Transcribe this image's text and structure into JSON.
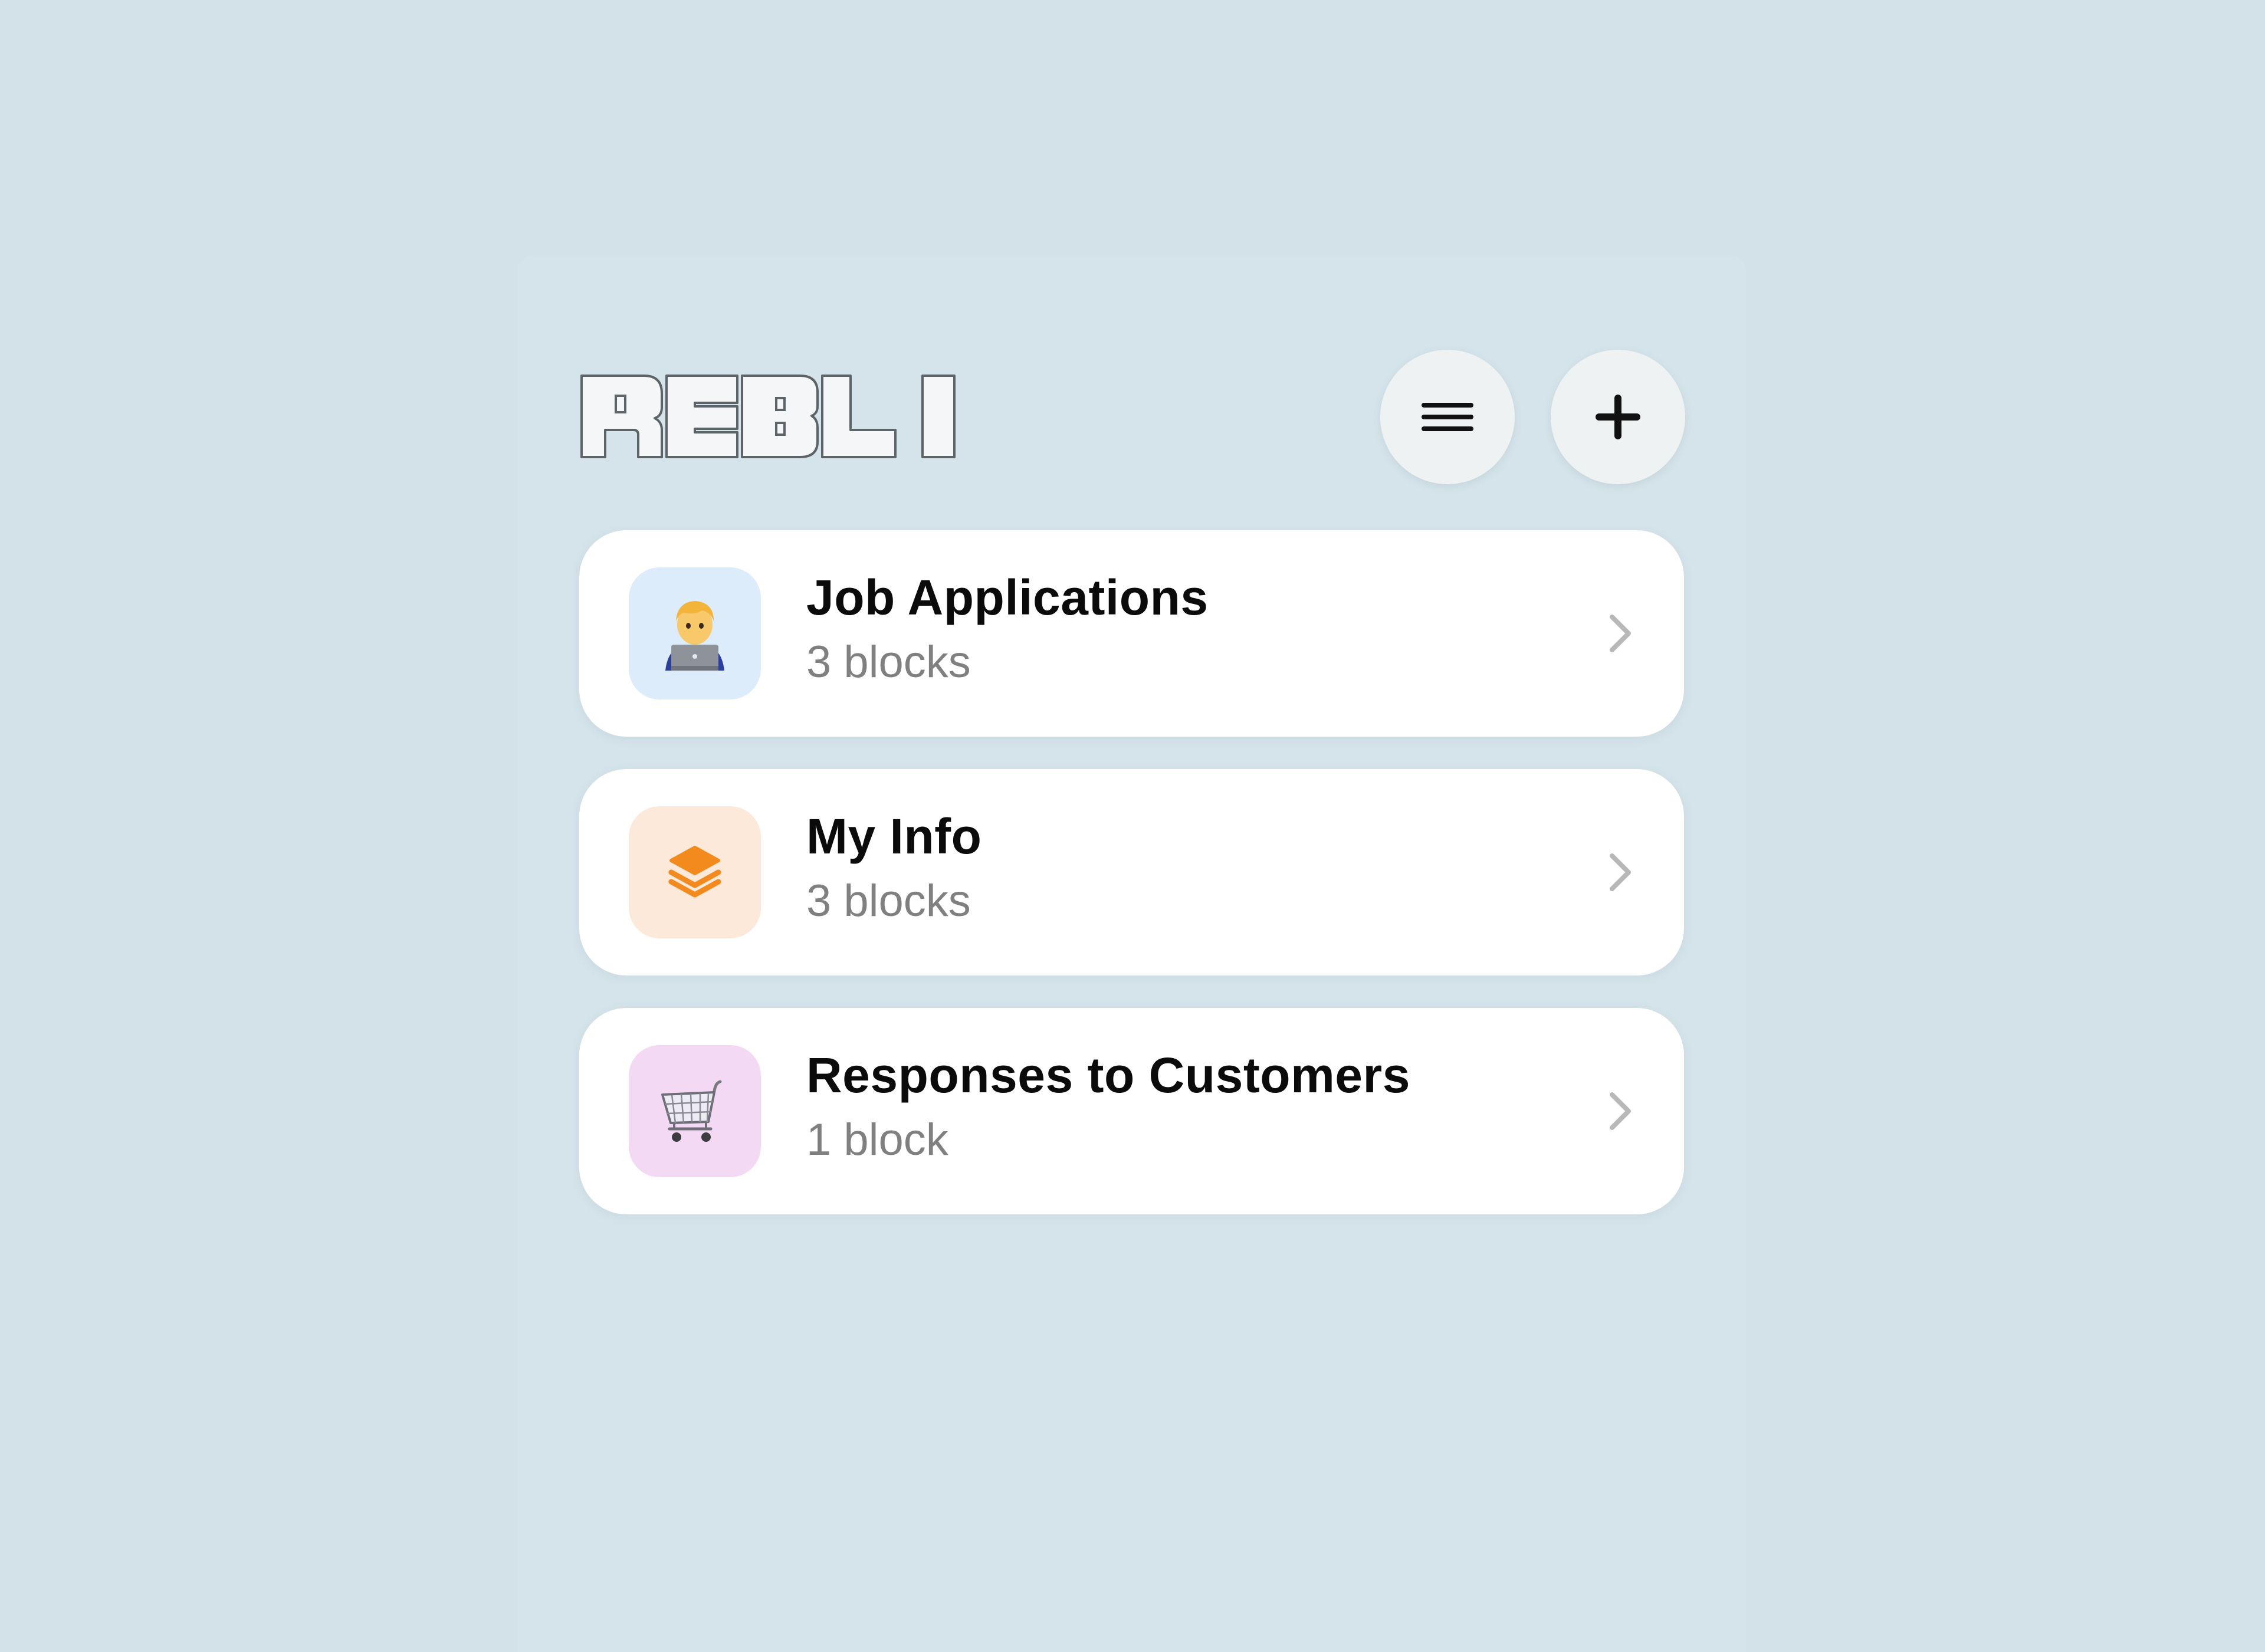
{
  "app": {
    "logo_text": "REBLI",
    "background_color": "#d3e2e8"
  },
  "header": {
    "menu_icon": "hamburger-icon",
    "add_icon": "plus-icon"
  },
  "collections": [
    {
      "title": "Job Applications",
      "count": "3 blocks",
      "icon": "technologist-emoji",
      "icon_bg": "#dcecfa"
    },
    {
      "title": "My Info",
      "count": "3 blocks",
      "icon": "layers-stack-icon",
      "icon_bg": "#fde9d9"
    },
    {
      "title": "Responses to Customers",
      "count": "1 block",
      "icon": "shopping-cart-emoji",
      "icon_bg": "#f3d9f3"
    }
  ]
}
